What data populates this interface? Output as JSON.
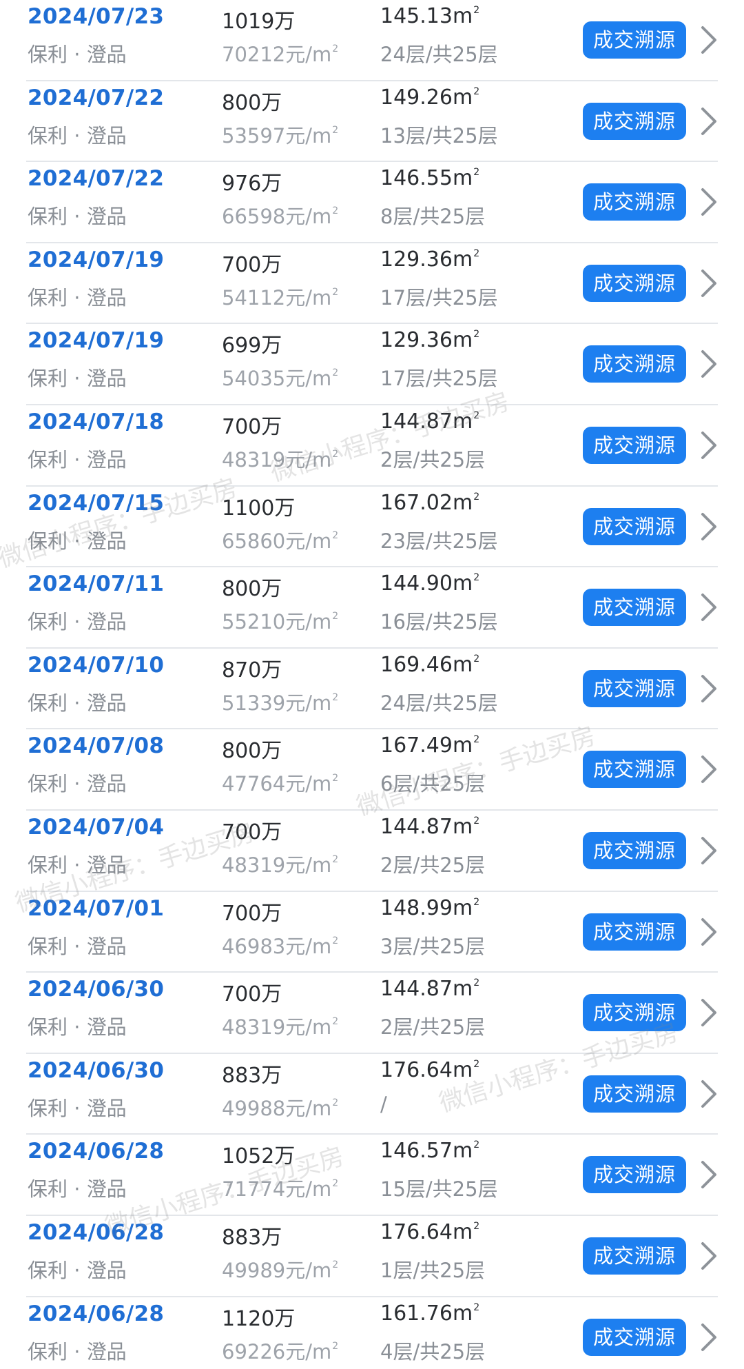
{
  "button_label": "成交溯源",
  "watermark_text": "微信小程序：手边买房",
  "sq_unit": "2",
  "records": [
    {
      "date": "2024/07/23",
      "project": "保利 · 澄品",
      "price": "1019万",
      "unit_price": "70212元/m",
      "area": "145.13m",
      "floor": "24层/共25层"
    },
    {
      "date": "2024/07/22",
      "project": "保利 · 澄品",
      "price": "800万",
      "unit_price": "53597元/m",
      "area": "149.26m",
      "floor": "13层/共25层"
    },
    {
      "date": "2024/07/22",
      "project": "保利 · 澄品",
      "price": "976万",
      "unit_price": "66598元/m",
      "area": "146.55m",
      "floor": "8层/共25层"
    },
    {
      "date": "2024/07/19",
      "project": "保利 · 澄品",
      "price": "700万",
      "unit_price": "54112元/m",
      "area": "129.36m",
      "floor": "17层/共25层"
    },
    {
      "date": "2024/07/19",
      "project": "保利 · 澄品",
      "price": "699万",
      "unit_price": "54035元/m",
      "area": "129.36m",
      "floor": "17层/共25层"
    },
    {
      "date": "2024/07/18",
      "project": "保利 · 澄品",
      "price": "700万",
      "unit_price": "48319元/m",
      "area": "144.87m",
      "floor": "2层/共25层"
    },
    {
      "date": "2024/07/15",
      "project": "保利 · 澄品",
      "price": "1100万",
      "unit_price": "65860元/m",
      "area": "167.02m",
      "floor": "23层/共25层"
    },
    {
      "date": "2024/07/11",
      "project": "保利 · 澄品",
      "price": "800万",
      "unit_price": "55210元/m",
      "area": "144.90m",
      "floor": "16层/共25层"
    },
    {
      "date": "2024/07/10",
      "project": "保利 · 澄品",
      "price": "870万",
      "unit_price": "51339元/m",
      "area": "169.46m",
      "floor": "24层/共25层"
    },
    {
      "date": "2024/07/08",
      "project": "保利 · 澄品",
      "price": "800万",
      "unit_price": "47764元/m",
      "area": "167.49m",
      "floor": "6层/共25层"
    },
    {
      "date": "2024/07/04",
      "project": "保利 · 澄品",
      "price": "700万",
      "unit_price": "48319元/m",
      "area": "144.87m",
      "floor": "2层/共25层"
    },
    {
      "date": "2024/07/01",
      "project": "保利 · 澄品",
      "price": "700万",
      "unit_price": "46983元/m",
      "area": "148.99m",
      "floor": "3层/共25层"
    },
    {
      "date": "2024/06/30",
      "project": "保利 · 澄品",
      "price": "700万",
      "unit_price": "48319元/m",
      "area": "144.87m",
      "floor": "2层/共25层"
    },
    {
      "date": "2024/06/30",
      "project": "保利 · 澄品",
      "price": "883万",
      "unit_price": "49988元/m",
      "area": "176.64m",
      "floor": "/"
    },
    {
      "date": "2024/06/28",
      "project": "保利 · 澄品",
      "price": "1052万",
      "unit_price": "71774元/m",
      "area": "146.57m",
      "floor": "15层/共25层"
    },
    {
      "date": "2024/06/28",
      "project": "保利 · 澄品",
      "price": "883万",
      "unit_price": "49989元/m",
      "area": "176.64m",
      "floor": "1层/共25层"
    },
    {
      "date": "2024/06/28",
      "project": "保利 · 澄品",
      "price": "1120万",
      "unit_price": "69226元/m",
      "area": "161.76m",
      "floor": "4层/共25层"
    }
  ]
}
